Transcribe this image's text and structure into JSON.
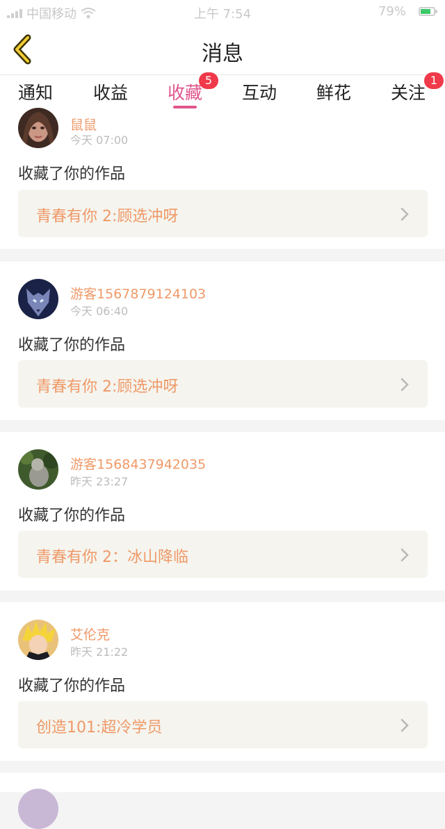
{
  "status_bar": {
    "carrier": "中国移动",
    "time": "上午 7:54",
    "battery": "79%"
  },
  "nav": {
    "title": "消息"
  },
  "tabs": [
    {
      "label": "通知",
      "badge": ""
    },
    {
      "label": "收益",
      "badge": ""
    },
    {
      "label": "收藏",
      "badge": "5",
      "active": true
    },
    {
      "label": "互动",
      "badge": ""
    },
    {
      "label": "鲜花",
      "badge": ""
    },
    {
      "label": "关注",
      "badge": "1"
    }
  ],
  "items": [
    {
      "username": "鼠鼠",
      "time": "今天 07:00",
      "action": "收藏了你的作品",
      "work": "青春有你 2:顾选冲呀",
      "avatar": "woman-portrait"
    },
    {
      "username": "游客1567879124103",
      "time": "今天 06:40",
      "action": "收藏了你的作品",
      "work": "青春有你 2:顾选冲呀",
      "avatar": "wolf"
    },
    {
      "username": "游客1568437942035",
      "time": "昨天 23:27",
      "action": "收藏了你的作品",
      "work": "青春有你 2：冰山降临",
      "avatar": "cat-in-forest"
    },
    {
      "username": "艾伦克",
      "time": "昨天 21:22",
      "action": "收藏了你的作品",
      "work": "创造101:超冷学员",
      "avatar": "anime-boy"
    }
  ],
  "colors": {
    "accent": "#e0558c",
    "badge": "#f0394a",
    "username": "#ef9968",
    "link_bg": "#f5f4ee"
  }
}
